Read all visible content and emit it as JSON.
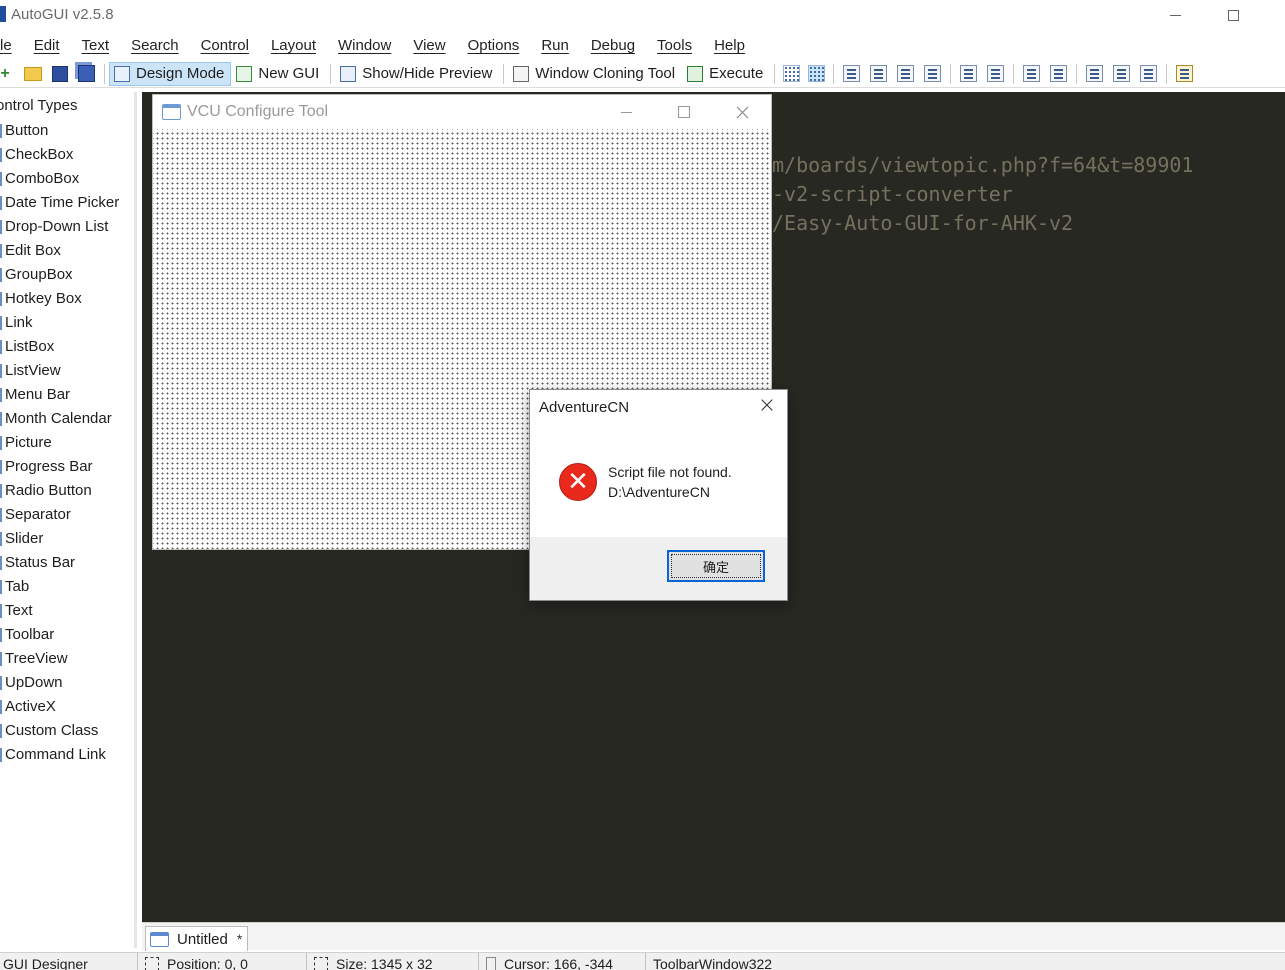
{
  "window": {
    "title": "AutoGUI v2.5.8"
  },
  "menu": [
    "le",
    "Edit",
    "Text",
    "Search",
    "Control",
    "Layout",
    "Window",
    "View",
    "Options",
    "Run",
    "Debug",
    "Tools",
    "Help"
  ],
  "toolbar": {
    "design_mode": "Design Mode",
    "new_gui": "New GUI",
    "show_hide_preview": "Show/Hide Preview",
    "window_cloning_tool": "Window Cloning Tool",
    "execute": "Execute"
  },
  "control_panel": {
    "header": "ontrol Types",
    "items": [
      "Button",
      "CheckBox",
      "ComboBox",
      "Date Time Picker",
      "Drop-Down List",
      "Edit Box",
      "GroupBox",
      "Hotkey Box",
      "Link",
      "ListBox",
      "ListView",
      "Menu Bar",
      "Month Calendar",
      "Picture",
      "Progress Bar",
      "Radio Button",
      "Separator",
      "Slider",
      "Status Bar",
      "Tab",
      "Text",
      "Toolbar",
      "TreeView",
      "UpDown",
      "ActiveX",
      "Custom Class",
      "Command Link"
    ]
  },
  "editor": {
    "lines": [
      "m/boards/viewtopic.php?f=64&t=89901",
      "-v2-script-converter",
      "/Easy-Auto-GUI-for-AHK-v2"
    ]
  },
  "preview_window": {
    "title": "VCU Configure Tool"
  },
  "message_box": {
    "title": "AdventureCN",
    "close_glyph": "×",
    "error_glyph": "✕",
    "line1": "Script file not found.",
    "line2": "D:\\AdventureCN",
    "ok_label": "确定"
  },
  "tab_bar": {
    "tab_label": "Untitled",
    "modified_marker": "*"
  },
  "status_bar": {
    "section": "GUI Designer",
    "position": "Position: 0, 0",
    "size": "Size: 1345 x 32",
    "cursor": "Cursor: 166, -344",
    "control": "ToolbarWindow322"
  },
  "colors": {
    "editor_bg": "#272822",
    "editor_text": "#75715e",
    "error_red": "#e8291c",
    "accent_blue": "#0a64d6"
  }
}
